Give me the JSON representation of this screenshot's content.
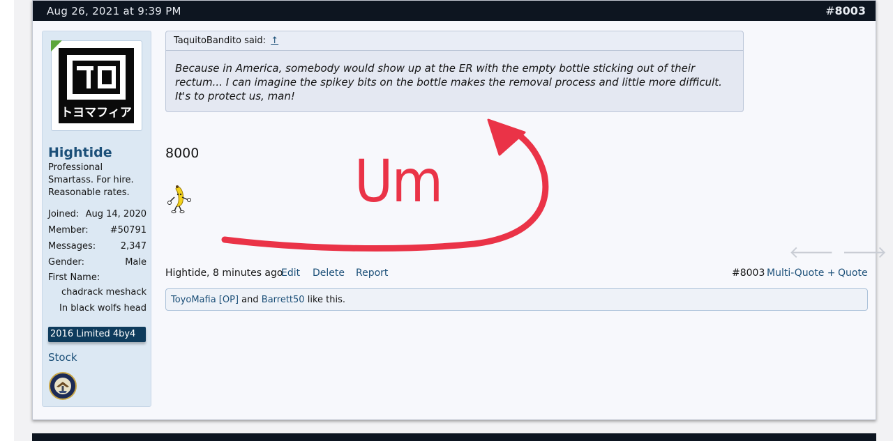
{
  "post": {
    "date": "Aug 26, 2021 at 9:39 PM",
    "number_prefix": "#",
    "number": "8003"
  },
  "user": {
    "name": "Hightide",
    "title": "Professional Smartass. For hire. Reasonable rates.",
    "avatar_text": "トヨマフィア",
    "avatar_icon": "toyomafia-logo",
    "stats": [
      {
        "label": "Joined:",
        "value": "Aug 14, 2020"
      },
      {
        "label": "Member:",
        "value": "#50791"
      },
      {
        "label": "Messages:",
        "value": "2,347"
      },
      {
        "label": "Gender:",
        "value": "Male"
      },
      {
        "label": "First Name:",
        "value": ""
      }
    ],
    "first_name_lines": [
      "chadrack meshack",
      "In black wolfs head"
    ],
    "vehicle": "2016 Limited 4by4",
    "modification": "Stock",
    "badge_icon": "navy-seal-icon"
  },
  "quote": {
    "author": "TaquitoBandito said:",
    "jump_icon": "↑",
    "text": "Because in America, somebody would show up at the ER with the empty bottle sticking out of their rectum... I can imagine the spikey bits on the bottle makes the removal process and little more difficult. It's to protect us, man!"
  },
  "message": {
    "text": "8000",
    "emoji_icon": "dancing-banana-icon"
  },
  "nav": {
    "prev_icon": "🡐",
    "next_icon": "🡒"
  },
  "footer": {
    "author_time": "Hightide, 8 minutes ago",
    "edit": "Edit",
    "delete": "Delete",
    "report": "Report",
    "post_number": "#8003",
    "multi_quote": "Multi-Quote +",
    "quote": "Quote"
  },
  "likes": {
    "user1": "ToyoMafia [OP]",
    "connector": "and",
    "user2": "Barrett50",
    "suffix": "like this."
  },
  "annotation": {
    "text": "Um",
    "color": "#ea3347"
  }
}
